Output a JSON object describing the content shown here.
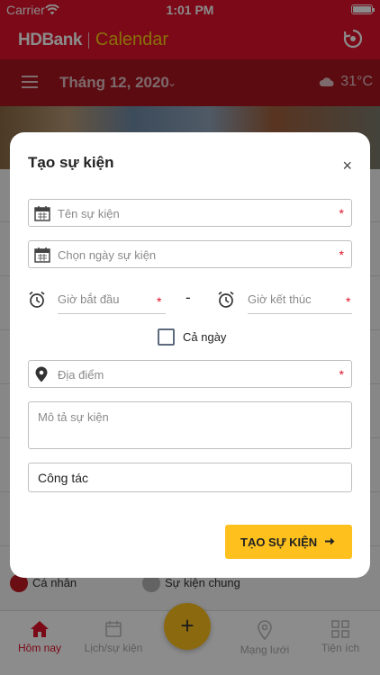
{
  "status": {
    "carrier": "Carrier",
    "time": "1:01 PM"
  },
  "header": {
    "brand_name": "HDBank",
    "app_name": "Calendar"
  },
  "subheader": {
    "month": "Tháng 12, 2020",
    "temperature": "31°C"
  },
  "legend": {
    "personal": "Cá nhân",
    "general": "Sự kiện chung"
  },
  "tabs": [
    {
      "label": "Hôm nay",
      "icon": "home-icon"
    },
    {
      "label": "Lịch/sự kiện",
      "icon": "calendar-icon"
    },
    {
      "label": "Mạng lưới",
      "icon": "location-pin-icon"
    },
    {
      "label": "Tiện ích",
      "icon": "grid-icon"
    }
  ],
  "fab": {
    "label": "+"
  },
  "modal": {
    "title": "Tạo sự kiện",
    "close": "×",
    "event_name_placeholder": "Tên sự kiện",
    "date_placeholder": "Chọn ngày sự kiện",
    "start_time_placeholder": "Giờ bắt đầu",
    "time_separator": "-",
    "end_time_placeholder": "Giờ kết thúc",
    "all_day_label": "Cả ngày",
    "location_placeholder": "Địa điểm",
    "description_placeholder": "Mô tả sự kiện",
    "event_type_value": "Công tác",
    "create_button": "TẠO SỰ KIỆN",
    "required_mark": "*"
  },
  "colors": {
    "brand_red": "#e1112a",
    "dark_red": "#a8141f",
    "accent_yellow": "#fdc01d"
  }
}
